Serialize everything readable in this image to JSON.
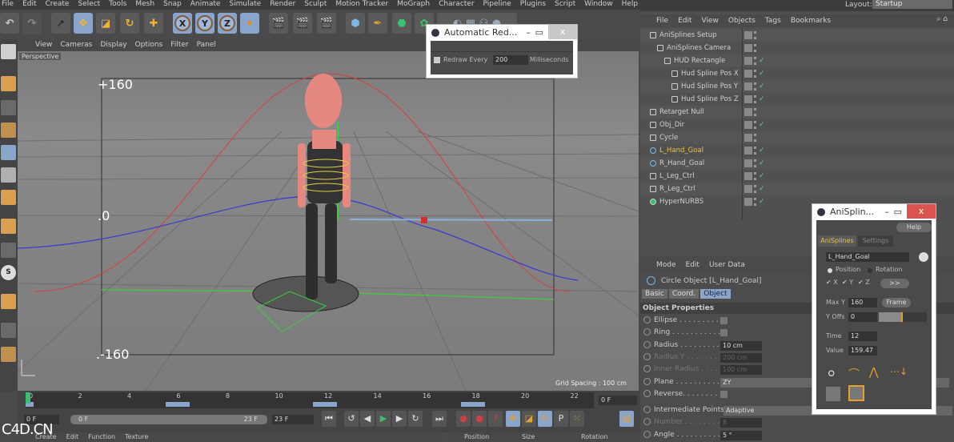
{
  "menu": [
    "File",
    "Edit",
    "Create",
    "Select",
    "Tools",
    "Mesh",
    "Snap",
    "Animate",
    "Simulate",
    "Render",
    "Sculpt",
    "Motion Tracker",
    "MoGraph",
    "Character",
    "Pipeline",
    "Plugins",
    "Script",
    "Window",
    "Help"
  ],
  "layout": {
    "label": "Layout:",
    "value": "Startup"
  },
  "toolbar": {
    "axis_x": "X",
    "axis_y": "Y",
    "axis_z": "Z"
  },
  "viewport": {
    "menu": [
      "View",
      "Cameras",
      "Display",
      "Options",
      "Filter",
      "Panel"
    ],
    "camera_label": "Perspective",
    "hud_max": "+160",
    "hud_zero": ".0",
    "hud_min": ".-160",
    "grid_spacing": "Grid Spacing : 100 cm"
  },
  "redraw_dialog": {
    "title": "Automatic Red...",
    "close": "x",
    "checkbox_label": "Redraw Every",
    "value": "200",
    "unit": "Milliseconds",
    "checked": true
  },
  "object_manager": {
    "menu": [
      "File",
      "Edit",
      "View",
      "Objects",
      "Tags",
      "Bookmarks"
    ],
    "objects": [
      {
        "name": "AniSplines Setup",
        "indent": 0,
        "icon": "null-icon",
        "check": false
      },
      {
        "name": "AniSplines Camera",
        "indent": 1,
        "icon": "camera-icon",
        "check": false
      },
      {
        "name": "HUD Rectangle",
        "indent": 2,
        "icon": "rectangle-icon",
        "check": true
      },
      {
        "name": "Hud Spline Pos X",
        "indent": 3,
        "icon": "spline-icon",
        "check": true
      },
      {
        "name": "Hud Spline Pos Y",
        "indent": 3,
        "icon": "spline-icon",
        "check": true
      },
      {
        "name": "Hud Spline Pos Z",
        "indent": 3,
        "icon": "spline-icon",
        "check": true
      },
      {
        "name": "Retarget Null",
        "indent": 0,
        "icon": "null-icon",
        "check": false
      },
      {
        "name": "Obj_Dir",
        "indent": 0,
        "icon": "spline-icon",
        "check": true
      },
      {
        "name": "Cycle",
        "indent": 0,
        "icon": "cycle-icon",
        "check": false
      },
      {
        "name": "L_Hand_Goal",
        "indent": 0,
        "icon": "circle-icon",
        "check": true,
        "selected": true
      },
      {
        "name": "R_Hand_Goal",
        "indent": 0,
        "icon": "circle-icon",
        "check": true
      },
      {
        "name": "L_Leg_Ctrl",
        "indent": 0,
        "icon": "spline-icon",
        "check": true
      },
      {
        "name": "R_Leg_Ctrl",
        "indent": 0,
        "icon": "spline-icon",
        "check": true
      },
      {
        "name": "HyperNURBS",
        "indent": 0,
        "icon": "hypernurbs-icon",
        "check": true
      }
    ]
  },
  "attribute_manager": {
    "menu": [
      "Mode",
      "Edit",
      "User Data"
    ],
    "title": "Circle Object [L_Hand_Goal]",
    "tabs": [
      "Basic",
      "Coord.",
      "Object"
    ],
    "active_tab": "Object",
    "section": "Object Properties",
    "props": [
      {
        "label": "Ellipse . . . . . . . . . .",
        "type": "checkbox",
        "value": ""
      },
      {
        "label": "Ring . . . . . . . . . . . .",
        "type": "checkbox",
        "value": ""
      },
      {
        "label": "Radius . . . . . . . . . .",
        "type": "field",
        "value": "10 cm"
      },
      {
        "label": "Radius Y . . . . . . . . .",
        "type": "field",
        "value": "200 cm",
        "disabled": true
      },
      {
        "label": "Inner Radius . . . . . .",
        "type": "field",
        "value": "100 cm",
        "disabled": true
      },
      {
        "label": "Plane . . . . . . . . . . .",
        "type": "dropdown",
        "value": "ZY"
      },
      {
        "label": "Reverse. . . . . . . . . .",
        "type": "checkbox",
        "value": ""
      },
      {
        "label": "Intermediate Points",
        "type": "dropdown",
        "value": "Adaptive"
      },
      {
        "label": "Number . . . . . . . . . .",
        "type": "field",
        "value": "8",
        "disabled": true
      },
      {
        "label": "Angle . . . . . . . . . . .",
        "type": "field",
        "value": "5 °"
      }
    ]
  },
  "anisplines": {
    "title": "AniSplin...",
    "close": "x",
    "help": "Help",
    "tabs": [
      "AniSplines",
      "Settings"
    ],
    "object": "L_Hand_Goal",
    "mode_position": "Position",
    "mode_rotation": "Rotation",
    "axes": [
      "X",
      "Y",
      "Z"
    ],
    "more": ">>",
    "max_y_label": "Max Y",
    "max_y": "160",
    "frame": "Frame",
    "y_offs_label": "Y Offs",
    "y_offs": "0",
    "y_offs_slider": 0.5,
    "time_label": "Time",
    "time": "12",
    "value_label": "Value",
    "value": "159.47"
  },
  "timeline": {
    "ticks": [
      "0",
      "2",
      "4",
      "6",
      "8",
      "10",
      "12",
      "14",
      "16",
      "18",
      "20",
      "22"
    ],
    "current_frame": "0 F",
    "start": "0 F",
    "range_start": "0 F",
    "range_end": "23 F",
    "end": "23 F"
  },
  "bottom": {
    "material_menu": [
      "Create",
      "Edit",
      "Function",
      "Texture"
    ],
    "coord_headers": [
      "Position",
      "Size",
      "Rotation"
    ]
  },
  "watermark": "C4D.CN",
  "colors": {
    "accent": "#8aa5cc",
    "selected_object": "#e6c34a",
    "close_red": "#d9534f",
    "check_green": "#6ad08a"
  }
}
